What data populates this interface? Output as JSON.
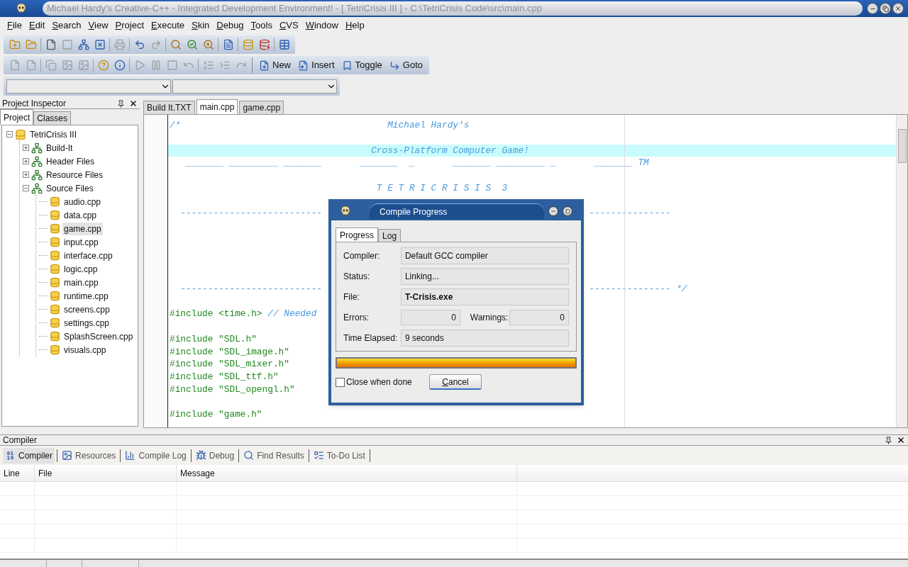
{
  "window": {
    "title": "Michael Hardy's Creative-C++ - Integrated Development Environment!  - [ TetriCrisis III ] - C:\\TetriCrisis Code\\src\\main.cpp"
  },
  "menu": [
    "File",
    "Edit",
    "Search",
    "View",
    "Project",
    "Execute",
    "Skin",
    "Debug",
    "Tools",
    "CVS",
    "Window",
    "Help"
  ],
  "toolbar_buttons": [
    {
      "label": "New",
      "kind": "new"
    },
    {
      "label": "Insert",
      "kind": "insert"
    },
    {
      "label": "Toggle",
      "kind": "toggle"
    },
    {
      "label": "Goto",
      "kind": "goto"
    }
  ],
  "project_inspector": {
    "title": "Project Inspector",
    "tabs": [
      {
        "label": "Project",
        "selected": true
      },
      {
        "label": "Classes",
        "selected": false
      }
    ],
    "tree": [
      {
        "label": "TetriCrisis III",
        "kind": "project",
        "expanded": true,
        "children": [
          {
            "label": "Build-It",
            "kind": "folder",
            "expanded": false
          },
          {
            "label": "Header Files",
            "kind": "folder",
            "expanded": false
          },
          {
            "label": "Resource Files",
            "kind": "folder",
            "expanded": false
          },
          {
            "label": "Source Files",
            "kind": "folder",
            "expanded": true,
            "children": [
              {
                "label": "audio.cpp",
                "kind": "file",
                "selected": false
              },
              {
                "label": "data.cpp",
                "kind": "file",
                "selected": false
              },
              {
                "label": "game.cpp",
                "kind": "file",
                "selected": true
              },
              {
                "label": "input.cpp",
                "kind": "file",
                "selected": false
              },
              {
                "label": "interface.cpp",
                "kind": "file",
                "selected": false
              },
              {
                "label": "logic.cpp",
                "kind": "file",
                "selected": false
              },
              {
                "label": "main.cpp",
                "kind": "file",
                "selected": false
              },
              {
                "label": "runtime.cpp",
                "kind": "file",
                "selected": false
              },
              {
                "label": "screens.cpp",
                "kind": "file",
                "selected": false
              },
              {
                "label": "settings.cpp",
                "kind": "file",
                "selected": false
              },
              {
                "label": "SplashScreen.cpp",
                "kind": "file",
                "selected": false
              },
              {
                "label": "visuals.cpp",
                "kind": "file",
                "selected": false
              }
            ]
          }
        ]
      }
    ]
  },
  "editor": {
    "tabs": [
      {
        "label": "Build It.TXT",
        "selected": false
      },
      {
        "label": "main.cpp",
        "selected": true
      },
      {
        "label": "game.cpp",
        "selected": false
      }
    ],
    "lines": [
      {
        "kind": "comment",
        "text": "/*                                      Michael Hardy's"
      },
      {
        "kind": "blank"
      },
      {
        "kind": "comment",
        "text": "                                     Cross-Platform Computer Game!",
        "highlighted": true
      },
      {
        "kind": "comment",
        "text": "   _______ _________ _______       _______  _       _______ _________ _       _______ TM"
      },
      {
        "kind": "blank"
      },
      {
        "kind": "comment",
        "text": "                                      T E T R I C R I S I S  3"
      },
      {
        "kind": "blank"
      },
      {
        "kind": "comment",
        "text": "  --------------------------",
        "right": "---------------"
      },
      {
        "kind": "blank"
      },
      {
        "kind": "blank"
      },
      {
        "kind": "blank"
      },
      {
        "kind": "blank"
      },
      {
        "kind": "blank"
      },
      {
        "kind": "comment",
        "text": "  --------------------------",
        "right": "--------------- */"
      },
      {
        "kind": "blank"
      },
      {
        "kind": "include",
        "text": "#include <time.h>",
        "comment": "// Needed"
      },
      {
        "kind": "blank"
      },
      {
        "kind": "include",
        "text": "#include \"SDL.h\""
      },
      {
        "kind": "include",
        "text": "#include \"SDL_image.h\""
      },
      {
        "kind": "include",
        "text": "#include \"SDL_mixer.h\""
      },
      {
        "kind": "include",
        "text": "#include \"SDL_ttf.h\""
      },
      {
        "kind": "include",
        "text": "#include \"SDL_opengl.h\""
      },
      {
        "kind": "blank"
      },
      {
        "kind": "include",
        "text": "#include \"game.h\""
      }
    ]
  },
  "dialog": {
    "title": "Compile Progress",
    "tabs": [
      {
        "label": "Progress",
        "selected": true
      },
      {
        "label": "Log",
        "selected": false
      }
    ],
    "compiler_label": "Compiler:",
    "compiler": "Default GCC compiler",
    "status_label": "Status:",
    "status": "Linking...",
    "file_label": "File:",
    "file": "T-Crisis.exe",
    "errors_label": "Errors:",
    "errors": "0",
    "warnings_label": "Warnings:",
    "warnings": "0",
    "time_label": "Time Elapsed:",
    "time": "9 seconds",
    "progress": {
      "level": 1
    },
    "close_when_done": {
      "label": "Close when done",
      "checked": false
    },
    "cancel": "Cancel"
  },
  "bottom_panel": {
    "title": "Compiler",
    "tabs": [
      {
        "label": "Compiler",
        "kind": "compiler",
        "selected": true
      },
      {
        "label": "Resources",
        "kind": "resources",
        "selected": false
      },
      {
        "label": "Compile Log",
        "kind": "log",
        "selected": false
      },
      {
        "label": "Debug",
        "kind": "debug",
        "selected": false
      },
      {
        "label": "Find Results",
        "kind": "find",
        "selected": false
      },
      {
        "label": "To-Do List",
        "kind": "todo",
        "selected": false
      }
    ],
    "columns": [
      "Line",
      "File",
      "Message"
    ]
  }
}
